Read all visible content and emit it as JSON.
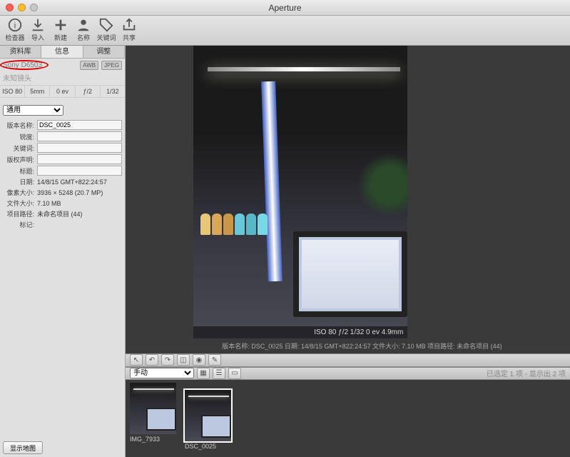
{
  "window": {
    "title": "Aperture"
  },
  "toolbar": {
    "items": [
      {
        "label": "检查器"
      },
      {
        "label": "导入"
      },
      {
        "label": "新建"
      },
      {
        "label": "名称"
      },
      {
        "label": "关键词"
      },
      {
        "label": "共享"
      }
    ]
  },
  "sidebar": {
    "tabs": {
      "library": "资料库",
      "info": "信息",
      "adjust": "调整"
    },
    "camera": {
      "model": "Sony D6503",
      "awb": "AWB",
      "format": "JPEG",
      "lens": "未知镜头"
    },
    "exif": {
      "iso": "ISO 80",
      "focal": "5mm",
      "ev": "0 ev",
      "aperture": "ƒ/2",
      "shutter": "1/32"
    },
    "preset": "通用",
    "meta": {
      "version_label": "版本名称:",
      "version": "DSC_0025",
      "alias_label": "锐度:",
      "keywords_label": "关键词:",
      "copyright_label": "版权声明:",
      "title_label": "标题:",
      "date_label": "日期:",
      "date": "14/8/15 GMT+822:24:57",
      "pixsize_label": "像素大小:",
      "pixsize": "3936 × 5248 (20.7 MP)",
      "filesize_label": "文件大小:",
      "filesize": "7.10 MB",
      "projpath_label": "项目路径:",
      "projpath": "未命名项目 (44)",
      "flag_label": "标记:"
    },
    "map_button": "显示地图"
  },
  "viewer": {
    "overlay": "ISO 80   ƒ/2   1/32   0 ev   4.9mm",
    "caption": "版本名称: DSC_0025   日期: 14/8/15 GMT+822:24:57  文件大小: 7.10 MB   项目路径: 未命名项目 (44)"
  },
  "browser": {
    "mode": "手动",
    "status": "已选定 1 项 - 显示出 2 项"
  },
  "thumbs": [
    {
      "label": "IMG_7933"
    },
    {
      "label": "DSC_0025"
    }
  ]
}
